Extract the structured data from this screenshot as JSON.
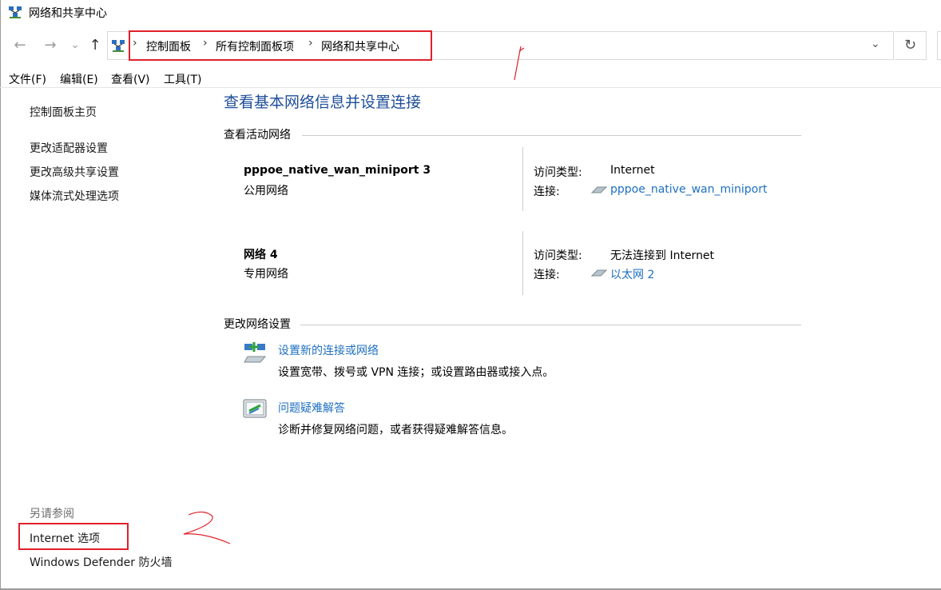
{
  "window": {
    "title": "网络和共享中心"
  },
  "nav": {
    "back": "←",
    "forward": "→",
    "recent": "⌄",
    "up": "↑",
    "refresh": "↻",
    "dropdown": "⌄"
  },
  "breadcrumb": {
    "items": [
      "控制面板",
      "所有控制面板项",
      "网络和共享中心"
    ],
    "separator": "›"
  },
  "menu": [
    "文件(F)",
    "编辑(E)",
    "查看(V)",
    "工具(T)"
  ],
  "sidebar": {
    "home": "控制面板主页",
    "links": [
      "更改适配器设置",
      "更改高级共享设置",
      "媒体流式处理选项"
    ],
    "see_also_title": "另请参阅",
    "see_also": [
      "Internet 选项",
      "Windows Defender 防火墙"
    ]
  },
  "main": {
    "heading": "查看基本网络信息并设置连接",
    "active_networks_title": "查看活动网络",
    "networks": [
      {
        "name": "pppoe_native_wan_miniport 3",
        "type": "公用网络",
        "access_label": "访问类型:",
        "access_value": "Internet",
        "conn_label": "连接:",
        "conn_value": "pppoe_native_wan_miniport"
      },
      {
        "name": "网络 4",
        "type": "专用网络",
        "access_label": "访问类型:",
        "access_value": "无法连接到 Internet",
        "conn_label": "连接:",
        "conn_value": "以太网 2"
      }
    ],
    "change_settings_title": "更改网络设置",
    "tasks": [
      {
        "title": "设置新的连接或网络",
        "desc": "设置宽带、拨号或 VPN 连接；或设置路由器或接入点。",
        "icon": "network-setup-icon"
      },
      {
        "title": "问题疑难解答",
        "desc": "诊断并修复网络问题，或者获得疑难解答信息。",
        "icon": "troubleshoot-icon"
      }
    ]
  },
  "annotations": {
    "one": "1",
    "two": "2"
  },
  "colors": {
    "link": "#1e6fc0",
    "heading": "#1e4e99",
    "highlight": "#e0202a"
  }
}
